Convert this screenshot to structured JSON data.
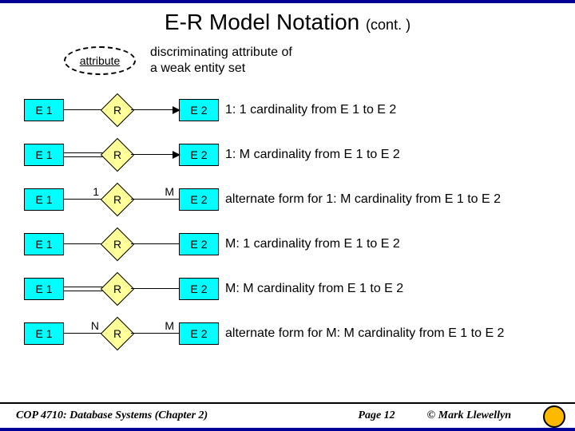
{
  "title": "E-R Model Notation",
  "title_cont": "(cont. )",
  "attr": {
    "label": "attribute",
    "desc_line1": "discriminating attribute of",
    "desc_line2": "a weak entity set"
  },
  "rows": [
    {
      "e1": "E 1",
      "r": "R",
      "e2": "E 2",
      "left_lbl": "",
      "right_lbl": "",
      "arrow": true,
      "double_left": false,
      "desc": "1: 1 cardinality from E 1 to E 2"
    },
    {
      "e1": "E 1",
      "r": "R",
      "e2": "E 2",
      "left_lbl": "",
      "right_lbl": "",
      "arrow": true,
      "double_left": true,
      "desc": "1: M cardinality from E 1 to E 2"
    },
    {
      "e1": "E 1",
      "r": "R",
      "e2": "E 2",
      "left_lbl": "1",
      "right_lbl": "M",
      "arrow": false,
      "double_left": false,
      "desc": "alternate form for 1: M cardinality from E 1 to E 2"
    },
    {
      "e1": "E 1",
      "r": "R",
      "e2": "E 2",
      "left_lbl": "",
      "right_lbl": "",
      "arrow": false,
      "double_left": false,
      "desc": "M: 1 cardinality from E 1 to E 2"
    },
    {
      "e1": "E 1",
      "r": "R",
      "e2": "E 2",
      "left_lbl": "",
      "right_lbl": "",
      "arrow": false,
      "double_left": true,
      "desc": "M: M cardinality from E 1 to E 2"
    },
    {
      "e1": "E 1",
      "r": "R",
      "e2": "E 2",
      "left_lbl": "N",
      "right_lbl": "M",
      "arrow": false,
      "double_left": false,
      "desc": "alternate form for M: M cardinality from E 1 to E 2"
    }
  ],
  "footer": {
    "course": "COP 4710: Database Systems (Chapter 2)",
    "page": "Page 12",
    "copyright": "© Mark Llewellyn"
  }
}
